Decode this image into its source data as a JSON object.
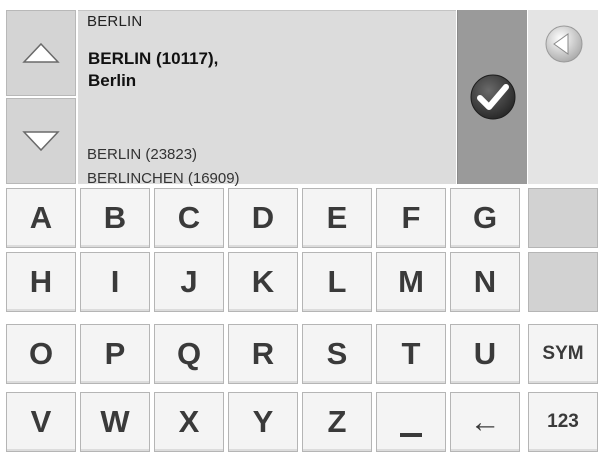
{
  "search": {
    "query": "BERLIN",
    "selected_line1": "BERLIN (10117),",
    "selected_line2": "Berlin",
    "results": [
      "BERLIN (23823)",
      "BERLINCHEN (16909)"
    ]
  },
  "icons": {
    "scroll_up": "triangle-up-icon",
    "scroll_down": "triangle-down-icon",
    "confirm": "checkmark-icon",
    "back": "back-arrow-icon"
  },
  "colors": {
    "confirm_panel": "#9a9a9a",
    "key_face": "#f4f4f4",
    "results_bg": "#dcdcdc"
  },
  "keyboard": {
    "rows": [
      [
        "A",
        "B",
        "C",
        "D",
        "E",
        "F",
        "G",
        ""
      ],
      [
        "H",
        "I",
        "J",
        "K",
        "L",
        "M",
        "N",
        ""
      ],
      [
        "O",
        "P",
        "Q",
        "R",
        "S",
        "T",
        "U",
        "SYM"
      ],
      [
        "V",
        "W",
        "X",
        "Y",
        "Z",
        "_",
        "←",
        "123"
      ]
    ]
  }
}
